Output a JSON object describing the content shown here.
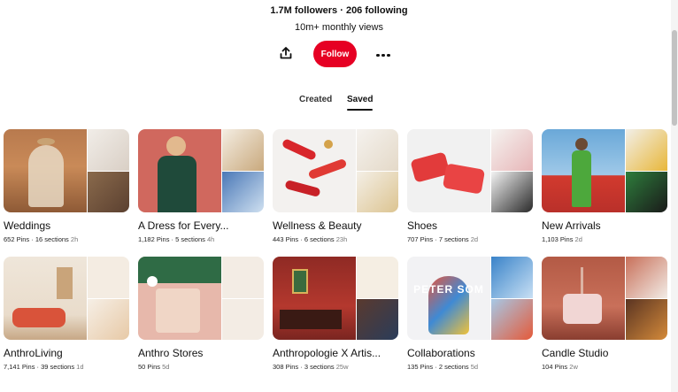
{
  "profile": {
    "stats": "1.7M followers · 206 following",
    "views": "10m+ monthly views",
    "follow_label": "Follow"
  },
  "icons": {
    "share": "share-icon",
    "more": "more-dots-icon"
  },
  "colors": {
    "accent": "#e60023"
  },
  "tabs": [
    {
      "label": "Created",
      "selected": false
    },
    {
      "label": "Saved",
      "selected": true
    }
  ],
  "boards": [
    {
      "name": "Weddings",
      "pins": "652 Pins",
      "sections": "16 sections",
      "age": "2h"
    },
    {
      "name": "A Dress for Every...",
      "pins": "1,182 Pins",
      "sections": "5 sections",
      "age": "4h"
    },
    {
      "name": "Wellness & Beauty",
      "pins": "443 Pins",
      "sections": "6 sections",
      "age": "23h"
    },
    {
      "name": "Shoes",
      "pins": "707 Pins",
      "sections": "7 sections",
      "age": "2d"
    },
    {
      "name": "New Arrivals",
      "pins": "1,103 Pins",
      "sections": "",
      "age": "2d"
    },
    {
      "name": "AnthroLiving",
      "pins": "7,141 Pins",
      "sections": "39 sections",
      "age": "1d"
    },
    {
      "name": "Anthro Stores",
      "pins": "50 Pins",
      "sections": "",
      "age": "5d"
    },
    {
      "name": "Anthropologie X Artis...",
      "pins": "308 Pins",
      "sections": "3 sections",
      "age": "25w"
    },
    {
      "name": "Collaborations",
      "pins": "135 Pins",
      "sections": "2 sections",
      "age": "5d"
    },
    {
      "name": "Candle Studio",
      "pins": "104 Pins",
      "sections": "",
      "age": "2w"
    }
  ],
  "cover_overlay_text": "PETER SOM"
}
